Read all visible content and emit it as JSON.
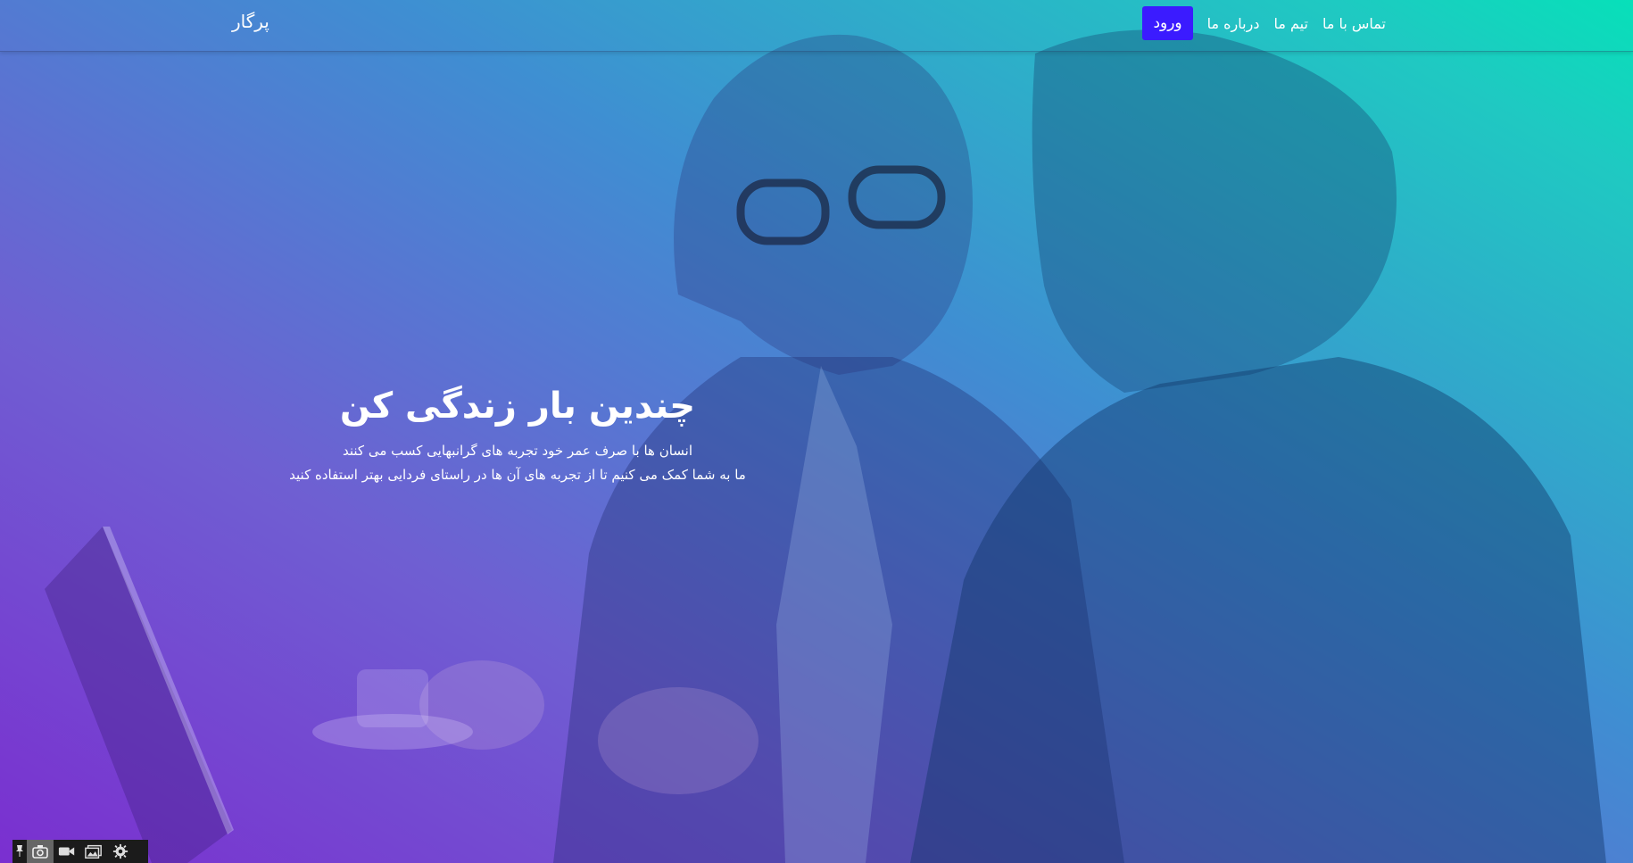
{
  "navbar": {
    "brand": "پرگار",
    "login_label": "ورود",
    "links": [
      "درباره ما",
      "تیم ما",
      "تماس با ما"
    ]
  },
  "hero": {
    "title": "چندین بار زندگی کن",
    "line1": "انسان ها با صرف عمر خود تجربه های گرانبهایی کسب می کنند",
    "line2": "ما به شما کمک می کنیم تا از تجربه های آن ها در راستای فردایی بهتر استفاده کنید"
  },
  "toolbar": {
    "icons": [
      "pin-icon",
      "camera-icon",
      "video-icon",
      "gallery-icon",
      "gear-icon"
    ]
  },
  "colors": {
    "login_button": "#3b1bff",
    "gradient_start": "#7a2fd0",
    "gradient_end": "#07e0b9"
  }
}
